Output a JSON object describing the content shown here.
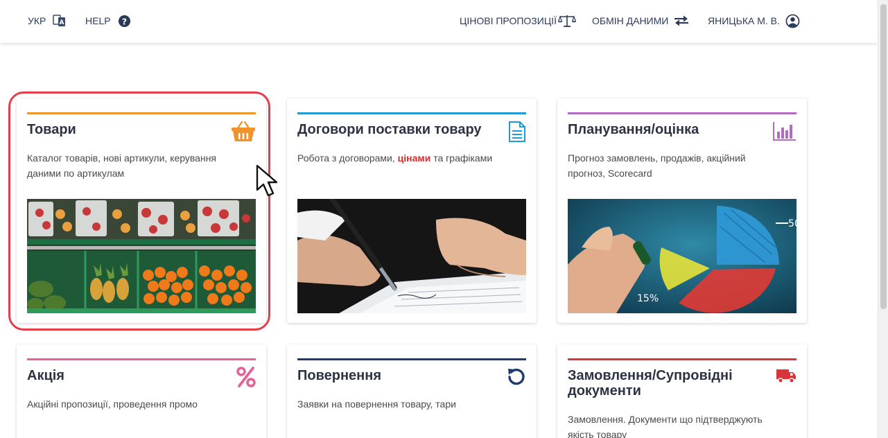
{
  "header": {
    "lang_label": "УКР",
    "help_label": "HELP",
    "price_offers_label": "ЦІНОВІ ПРОПОЗИЦІЇ",
    "data_exchange_label": "ОБМІН ДАНИМИ",
    "user_label": "ЯНИЦЬКА М. В."
  },
  "colors": {
    "goods": "#f0932b",
    "contracts": "#1e9ad6",
    "planning": "#b06cc0",
    "promo": "#e5609a",
    "returns": "#1e3a6e",
    "orders": "#d9343c"
  },
  "cards": [
    {
      "title": "Товари",
      "icon": "basket-icon",
      "description": "Каталог товарів, нові артикули, керування даними по артикулам"
    },
    {
      "title": "Договори поставки товару",
      "icon": "document-icon",
      "description_pre": "Робота з договорами, ",
      "description_highlight": "цінами",
      "description_post": " та графіками"
    },
    {
      "title": "Планування/оцінка",
      "icon": "bar-chart-icon",
      "description": "Прогноз замовлень, продажів, акційний прогноз, Scorecard"
    },
    {
      "title": "Акція",
      "icon": "percent-icon",
      "description": "Акційні пропозиції, проведення промо"
    },
    {
      "title": "Повернення",
      "icon": "undo-icon",
      "description": "Заявки на повернення товару, тари"
    },
    {
      "title": "Замовлення/Супровідні документи",
      "icon": "truck-icon",
      "description": "Замовлення. Документи що підтверджують якість товару"
    }
  ]
}
